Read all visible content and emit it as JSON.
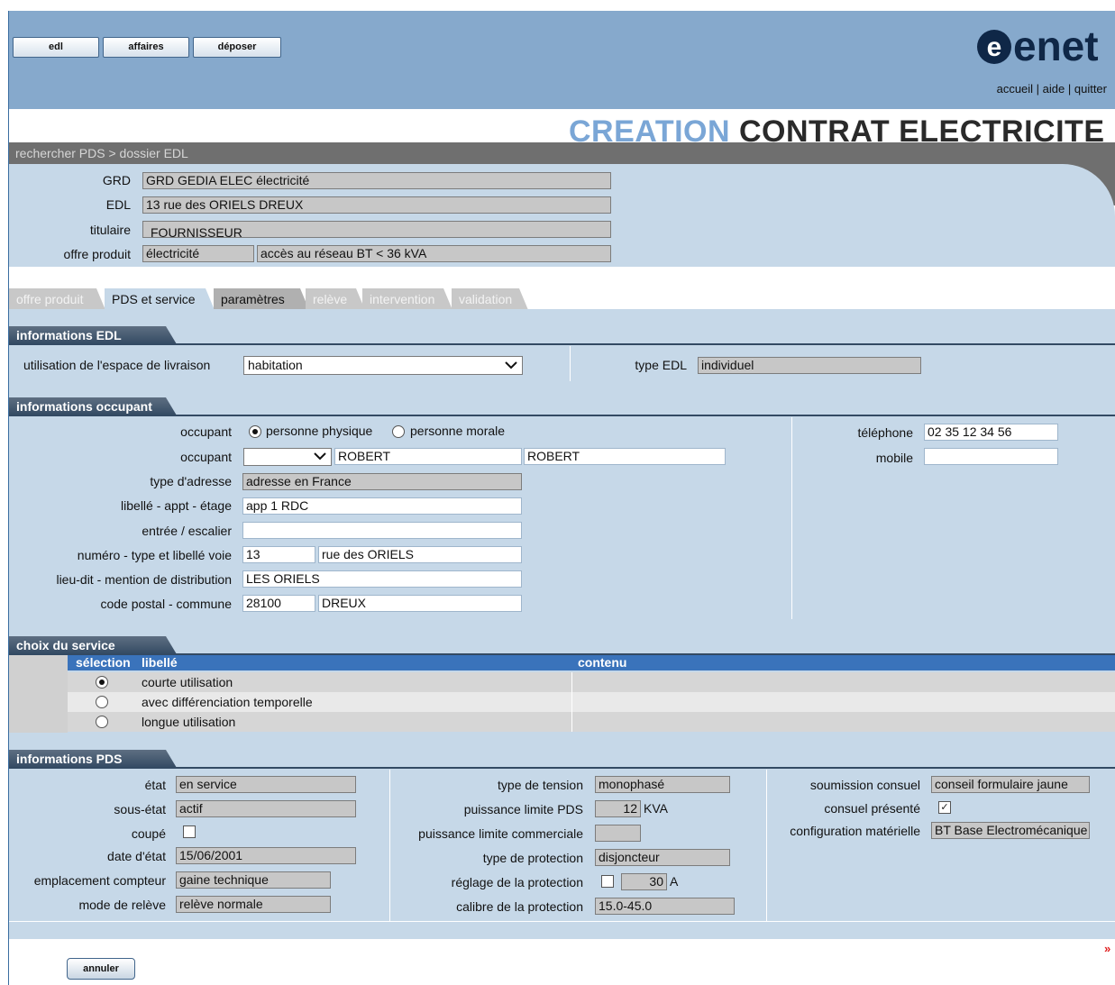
{
  "nav": {
    "buttons": [
      "edl",
      "affaires",
      "déposer"
    ]
  },
  "logo": {
    "text": "enet"
  },
  "links": {
    "accueil": "accueil",
    "aide": "aide",
    "quitter": "quitter",
    "sep": " | "
  },
  "title": {
    "part1": "CREATION",
    "part2": " CONTRAT ELECTRICITE"
  },
  "breadcrumb": "rechercher PDS > dossier EDL",
  "edl": {
    "grd_label": "GRD",
    "grd": "GRD GEDIA ELEC électricité",
    "edl_label": "EDL",
    "edl": "13 rue des ORIELS DREUX",
    "titulaire_label": "titulaire",
    "titulaire": "FOURNISSEUR",
    "offre_label": "offre produit",
    "offre1": "électricité",
    "offre2": "accès au réseau BT < 36 kVA"
  },
  "tabs": [
    "offre produit",
    "PDS et service",
    "paramètres",
    "relève",
    "intervention",
    "validation"
  ],
  "info_edl": {
    "header": "informations EDL",
    "usage_label": "utilisation de l'espace de livraison",
    "usage_value": "habitation",
    "type_label": "type EDL",
    "type_value": "individuel"
  },
  "occupant": {
    "header": "informations occupant",
    "occ_label": "occupant",
    "radio1": "personne physique",
    "radio2": "personne morale",
    "selected": "personne physique",
    "occ2_label": "occupant",
    "civility": "",
    "nom": "ROBERT",
    "prenom": "ROBERT",
    "typeadr_label": "type d'adresse",
    "typeadr": "adresse en France",
    "libelle_label": "libellé - appt - étage",
    "libelle": "app 1 RDC",
    "entree_label": "entrée / escalier",
    "entree": "",
    "numero_label": "numéro - type et libellé voie",
    "numero": "13",
    "voie": "rue des ORIELS",
    "lieudit_label": "lieu-dit - mention de distribution",
    "lieudit": "LES ORIELS",
    "cp_label": "code postal - commune",
    "cp": "28100",
    "commune": "DREUX",
    "tel_label": "téléphone",
    "tel": "02 35 12 34 56",
    "mobile_label": "mobile",
    "mobile": ""
  },
  "service": {
    "header": "choix du service",
    "col_selection": "sélection",
    "col_libelle": "libellé",
    "col_contenu": "contenu",
    "rows": [
      {
        "label": "courte utilisation",
        "selected": true
      },
      {
        "label": "avec différenciation temporelle",
        "selected": false
      },
      {
        "label": "longue utilisation",
        "selected": false
      }
    ]
  },
  "pds": {
    "header": "informations PDS",
    "etat_label": "état",
    "etat": "en service",
    "sousetat_label": "sous-état",
    "sousetat": "actif",
    "coupe_label": "coupé",
    "coupe": false,
    "date_label": "date d'état",
    "date": "15/06/2001",
    "empl_label": "emplacement compteur",
    "empl": "gaine technique",
    "mode_label": "mode de relève",
    "mode": "relève normale",
    "tension_label": "type de tension",
    "tension": "monophasé",
    "plimite_label": "puissance limite PDS",
    "plimite": "12",
    "plimite_unit": "KVA",
    "pcomm_label": "puissance limite commerciale",
    "pcomm": "",
    "protection_label": "type de protection",
    "protection": "disjoncteur",
    "reglage_label": "réglage de la protection",
    "reglage": "30",
    "reglage_unit": "A",
    "reglage_check": false,
    "calibre_label": "calibre de la protection",
    "calibre": "15.0-45.0",
    "soumission_label": "soumission consuel",
    "soumission": "conseil formulaire jaune",
    "consuel_label": "consuel présenté",
    "consuel": true,
    "config_label": "configuration matérielle",
    "config": "BT Base Electromécanique"
  },
  "footer": {
    "annuler": "annuler",
    "mark": "»"
  },
  "colors": {
    "header_blue": "#86a9cc",
    "panel_blue": "#c6d8e8",
    "section_dark": "#334a63",
    "title_blue": "#7aa6d6",
    "table_header": "#3a73bb"
  }
}
